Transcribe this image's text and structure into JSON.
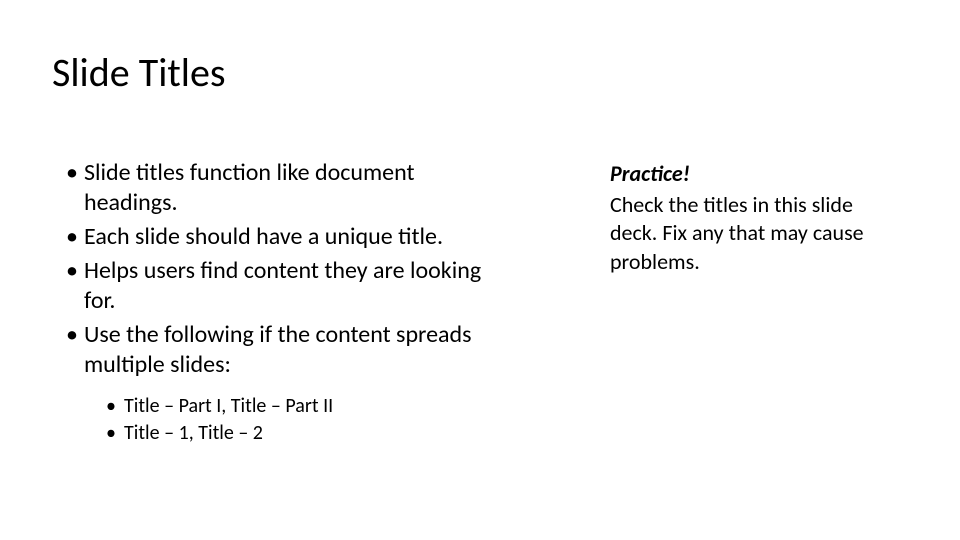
{
  "title": "Slide Titles",
  "bullets": [
    "Slide titles function like document headings.",
    "Each slide should have a unique title.",
    "Helps users find content they are looking for.",
    "Use the following if the content spreads multiple slides:"
  ],
  "sub_bullets": [
    "Title – Part I, Title – Part II",
    "Title – 1, Title – 2"
  ],
  "practice_heading": "Practice!",
  "practice_body": "Check the titles in this slide deck. Fix any that may cause problems."
}
